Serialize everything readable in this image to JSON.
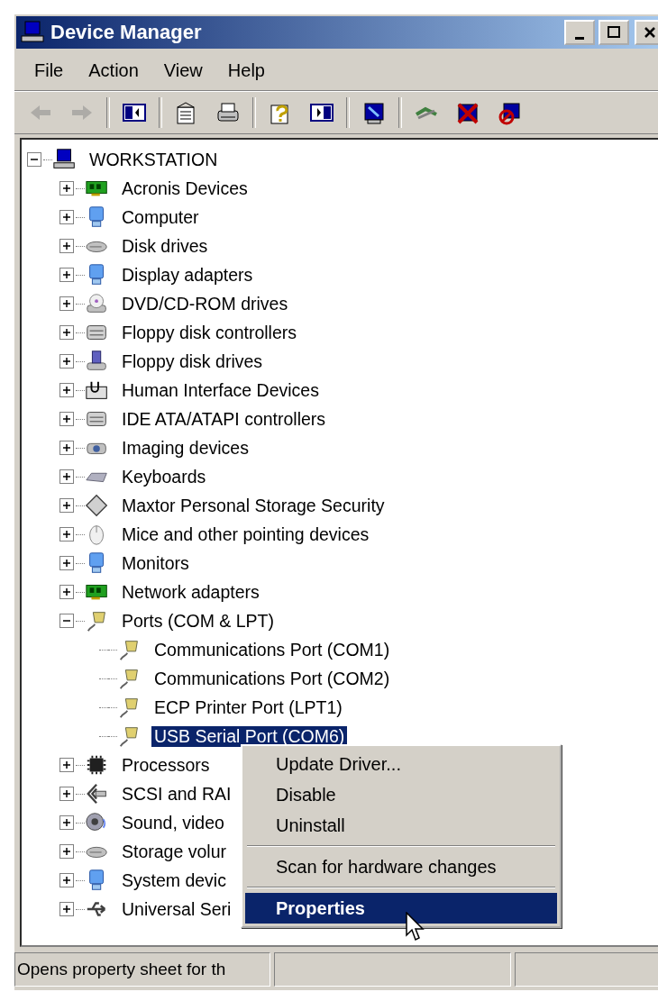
{
  "window": {
    "title": "Device Manager"
  },
  "menu_bar": [
    "File",
    "Action",
    "View",
    "Help"
  ],
  "toolbar": [
    {
      "kind": "back",
      "disabled": true
    },
    {
      "kind": "forward",
      "disabled": true
    },
    {
      "kind": "separator"
    },
    {
      "kind": "tree-pane",
      "disabled": false
    },
    {
      "kind": "separator"
    },
    {
      "kind": "properties",
      "disabled": false
    },
    {
      "kind": "print",
      "disabled": false
    },
    {
      "kind": "separator"
    },
    {
      "kind": "help",
      "disabled": false
    },
    {
      "kind": "action-pane",
      "disabled": false
    },
    {
      "kind": "separator"
    },
    {
      "kind": "scan",
      "disabled": false
    },
    {
      "kind": "separator"
    },
    {
      "kind": "update",
      "disabled": false
    },
    {
      "kind": "uninstall",
      "disabled": false
    },
    {
      "kind": "disable",
      "disabled": false
    }
  ],
  "tree": {
    "label": "WORKSTATION",
    "kind": "computer",
    "expanded": true,
    "selected": false,
    "children": [
      {
        "label": "Acronis Devices",
        "kind": "board",
        "expanded": false,
        "selected": false
      },
      {
        "label": "Computer",
        "kind": "monitor",
        "expanded": false,
        "selected": false
      },
      {
        "label": "Disk drives",
        "kind": "disk",
        "expanded": false,
        "selected": false
      },
      {
        "label": "Display adapters",
        "kind": "monitor",
        "expanded": false,
        "selected": false
      },
      {
        "label": "DVD/CD-ROM drives",
        "kind": "cdrom",
        "expanded": false,
        "selected": false
      },
      {
        "label": "Floppy disk controllers",
        "kind": "controller",
        "expanded": false,
        "selected": false
      },
      {
        "label": "Floppy disk drives",
        "kind": "floppy",
        "expanded": false,
        "selected": false
      },
      {
        "label": "Human Interface Devices",
        "kind": "hid",
        "expanded": false,
        "selected": false
      },
      {
        "label": "IDE ATA/ATAPI controllers",
        "kind": "controller",
        "expanded": false,
        "selected": false
      },
      {
        "label": "Imaging devices",
        "kind": "camera",
        "expanded": false,
        "selected": false
      },
      {
        "label": "Keyboards",
        "kind": "keyboard",
        "expanded": false,
        "selected": false
      },
      {
        "label": "Maxtor Personal Storage Security",
        "kind": "diamond",
        "expanded": false,
        "selected": false
      },
      {
        "label": "Mice and other pointing devices",
        "kind": "mouse",
        "expanded": false,
        "selected": false
      },
      {
        "label": "Monitors",
        "kind": "monitor",
        "expanded": false,
        "selected": false
      },
      {
        "label": "Network adapters",
        "kind": "board",
        "expanded": false,
        "selected": false
      },
      {
        "label": "Ports (COM & LPT)",
        "kind": "port",
        "expanded": true,
        "selected": false,
        "children": [
          {
            "label": "Communications Port (COM1)",
            "kind": "port",
            "selected": false
          },
          {
            "label": "Communications Port (COM2)",
            "kind": "port",
            "selected": false
          },
          {
            "label": "ECP Printer Port (LPT1)",
            "kind": "port",
            "selected": false
          },
          {
            "label": "USB Serial Port (COM6)",
            "kind": "port",
            "selected": true
          }
        ]
      },
      {
        "label": "Processors",
        "kind": "chip",
        "expanded": false,
        "selected": false
      },
      {
        "label": "SCSI and RAI",
        "kind": "scsi",
        "expanded": false,
        "selected": false
      },
      {
        "label": "Sound, video",
        "kind": "sound",
        "expanded": false,
        "selected": false
      },
      {
        "label": "Storage volur",
        "kind": "disk",
        "expanded": false,
        "selected": false
      },
      {
        "label": "System devic",
        "kind": "monitor",
        "expanded": false,
        "selected": false
      },
      {
        "label": "Universal Seri",
        "kind": "usb",
        "expanded": false,
        "selected": false
      }
    ]
  },
  "context_menu": [
    {
      "kind": "item",
      "label": "Update Driver...",
      "selected": false,
      "default": false
    },
    {
      "kind": "item",
      "label": "Disable",
      "selected": false,
      "default": false
    },
    {
      "kind": "item",
      "label": "Uninstall",
      "selected": false,
      "default": false
    },
    {
      "kind": "separator"
    },
    {
      "kind": "item",
      "label": "Scan for hardware changes",
      "selected": false,
      "default": false
    },
    {
      "kind": "separator"
    },
    {
      "kind": "item",
      "label": "Properties",
      "selected": true,
      "default": true
    }
  ],
  "status_bar": {
    "text": "Opens property sheet for th"
  }
}
